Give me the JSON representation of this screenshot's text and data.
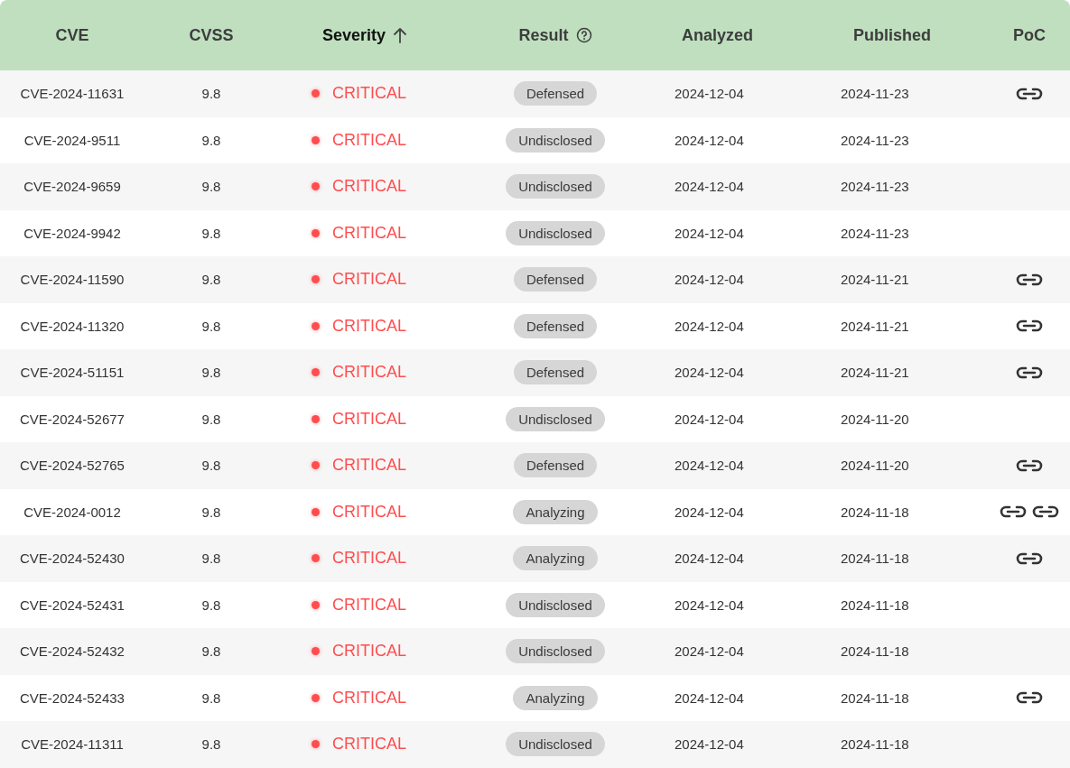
{
  "columns": [
    {
      "label": "CVE",
      "sorted": false,
      "help": false
    },
    {
      "label": "CVSS",
      "sorted": false,
      "help": false
    },
    {
      "label": "Severity",
      "sorted": true,
      "help": false
    },
    {
      "label": "Result",
      "sorted": false,
      "help": true
    },
    {
      "label": "Analyzed",
      "sorted": false,
      "help": false
    },
    {
      "label": "Published",
      "sorted": false,
      "help": false
    },
    {
      "label": "PoC",
      "sorted": false,
      "help": false
    }
  ],
  "rows": [
    {
      "cve": "CVE-2024-11631",
      "cvss": "9.8",
      "severity": "CRITICAL",
      "result": "Defensed",
      "analyzed": "2024-12-04",
      "published": "2024-11-23",
      "poc": [
        {
          "kind": "link"
        }
      ]
    },
    {
      "cve": "CVE-2024-9511",
      "cvss": "9.8",
      "severity": "CRITICAL",
      "result": "Undisclosed",
      "analyzed": "2024-12-04",
      "published": "2024-11-23",
      "poc": []
    },
    {
      "cve": "CVE-2024-9659",
      "cvss": "9.8",
      "severity": "CRITICAL",
      "result": "Undisclosed",
      "analyzed": "2024-12-04",
      "published": "2024-11-23",
      "poc": []
    },
    {
      "cve": "CVE-2024-9942",
      "cvss": "9.8",
      "severity": "CRITICAL",
      "result": "Undisclosed",
      "analyzed": "2024-12-04",
      "published": "2024-11-23",
      "poc": []
    },
    {
      "cve": "CVE-2024-11590",
      "cvss": "9.8",
      "severity": "CRITICAL",
      "result": "Defensed",
      "analyzed": "2024-12-04",
      "published": "2024-11-21",
      "poc": [
        {
          "kind": "link"
        }
      ]
    },
    {
      "cve": "CVE-2024-11320",
      "cvss": "9.8",
      "severity": "CRITICAL",
      "result": "Defensed",
      "analyzed": "2024-12-04",
      "published": "2024-11-21",
      "poc": [
        {
          "kind": "link"
        }
      ]
    },
    {
      "cve": "CVE-2024-51151",
      "cvss": "9.8",
      "severity": "CRITICAL",
      "result": "Defensed",
      "analyzed": "2024-12-04",
      "published": "2024-11-21",
      "poc": [
        {
          "kind": "link"
        }
      ]
    },
    {
      "cve": "CVE-2024-52677",
      "cvss": "9.8",
      "severity": "CRITICAL",
      "result": "Undisclosed",
      "analyzed": "2024-12-04",
      "published": "2024-11-20",
      "poc": []
    },
    {
      "cve": "CVE-2024-52765",
      "cvss": "9.8",
      "severity": "CRITICAL",
      "result": "Defensed",
      "analyzed": "2024-12-04",
      "published": "2024-11-20",
      "poc": [
        {
          "kind": "link"
        }
      ]
    },
    {
      "cve": "CVE-2024-0012",
      "cvss": "9.8",
      "severity": "CRITICAL",
      "result": "Analyzing",
      "analyzed": "2024-12-04",
      "published": "2024-11-18",
      "poc": [
        {
          "kind": "link"
        },
        {
          "kind": "link"
        }
      ]
    },
    {
      "cve": "CVE-2024-52430",
      "cvss": "9.8",
      "severity": "CRITICAL",
      "result": "Analyzing",
      "analyzed": "2024-12-04",
      "published": "2024-11-18",
      "poc": [
        {
          "kind": "link"
        }
      ]
    },
    {
      "cve": "CVE-2024-52431",
      "cvss": "9.8",
      "severity": "CRITICAL",
      "result": "Undisclosed",
      "analyzed": "2024-12-04",
      "published": "2024-11-18",
      "poc": []
    },
    {
      "cve": "CVE-2024-52432",
      "cvss": "9.8",
      "severity": "CRITICAL",
      "result": "Undisclosed",
      "analyzed": "2024-12-04",
      "published": "2024-11-18",
      "poc": []
    },
    {
      "cve": "CVE-2024-52433",
      "cvss": "9.8",
      "severity": "CRITICAL",
      "result": "Analyzing",
      "analyzed": "2024-12-04",
      "published": "2024-11-18",
      "poc": [
        {
          "kind": "link"
        }
      ]
    },
    {
      "cve": "CVE-2024-11311",
      "cvss": "9.8",
      "severity": "CRITICAL",
      "result": "Undisclosed",
      "analyzed": "2024-12-04",
      "published": "2024-11-18",
      "poc": []
    }
  ]
}
